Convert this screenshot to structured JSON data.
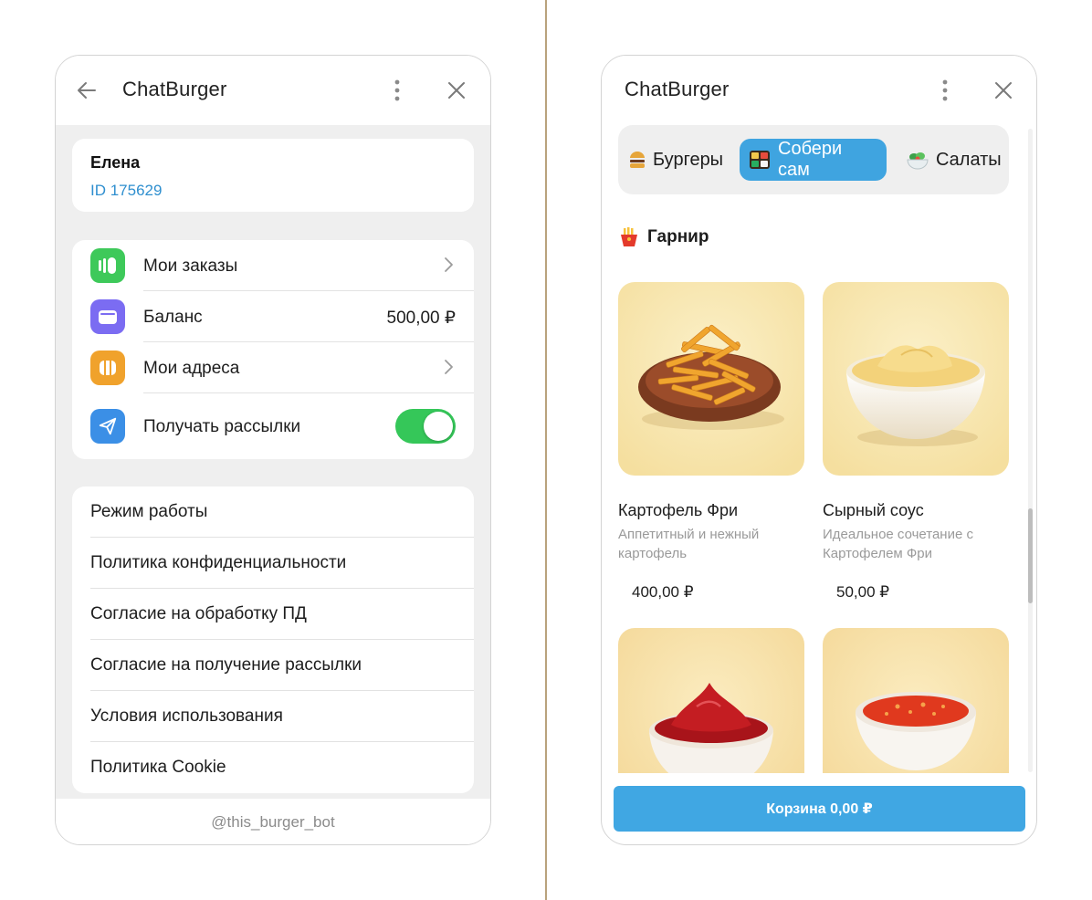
{
  "colors": {
    "accent": "#40a7e3",
    "active_tab": "#3fa4e0",
    "link": "#2f8fcf",
    "toggle_on": "#35c759",
    "orders_icon_bg": "#3ec95a",
    "balance_icon_bg": "#7b6cf2",
    "addresses_icon_bg": "#f0a22c",
    "newsletter_icon_bg": "#3b8fe6",
    "divider": "#b9a27c"
  },
  "left_window": {
    "title": "ChatBurger",
    "icons": {
      "back": "arrow-left-icon",
      "more": "more-vertical-icon",
      "close": "close-icon"
    },
    "profile": {
      "name": "Елена",
      "id": "ID 175629"
    },
    "menu": [
      {
        "label": "Мои заказы",
        "icon": "orders-icon",
        "trailing": "chevron"
      },
      {
        "label": "Баланс",
        "icon": "wallet-icon",
        "value": "500,00 ₽"
      },
      {
        "label": "Мои адреса",
        "icon": "addresses-icon",
        "trailing": "chevron"
      },
      {
        "label": "Получать рассылки",
        "icon": "paper-plane-icon",
        "toggle": true
      }
    ],
    "links": [
      {
        "label": "Режим работы"
      },
      {
        "label": "Политика конфиденциальности"
      },
      {
        "label": "Согласие на обработку ПД"
      },
      {
        "label": "Согласие на получение рассылки"
      },
      {
        "label": "Условия использования"
      },
      {
        "label": "Политика Cookie"
      }
    ],
    "footer": "@this_burger_bot"
  },
  "right_window": {
    "title": "ChatBurger",
    "icons": {
      "more": "more-vertical-icon",
      "close": "close-icon"
    },
    "tabs": [
      {
        "label": "Бургеры",
        "icon": "burger-icon",
        "active": false
      },
      {
        "label": "Собери сам",
        "icon": "bento-icon",
        "active": true
      },
      {
        "label": "Салаты",
        "icon": "salad-icon",
        "active": false
      }
    ],
    "section": {
      "title": "Гарнир",
      "icon": "fries-icon"
    },
    "products": [
      {
        "name": "Картофель Фри",
        "desc": "Аппетитный и нежный картофель",
        "price": "400,00 ₽",
        "image": "fries-plate-image"
      },
      {
        "name": "Сырный соус",
        "desc": "Идеальное сочетание с Картофелем Фри",
        "price": "50,00 ₽",
        "image": "cheese-sauce-image"
      },
      {
        "name": "",
        "desc": "",
        "price": "",
        "image": "ketchup-bowl-image"
      },
      {
        "name": "",
        "desc": "",
        "price": "",
        "image": "sweet-chili-sauce-image"
      }
    ],
    "cart_button": "Корзина 0,00 ₽"
  }
}
